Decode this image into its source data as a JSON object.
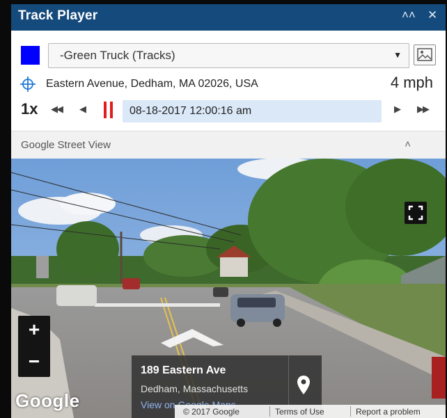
{
  "titlebar": {
    "title": "Track Player",
    "collapse_glyph": "˄˄",
    "close_glyph": "✕"
  },
  "track": {
    "swatch_color": "#0000ff",
    "selected": "-Green Truck (Tracks)",
    "caret": "▼"
  },
  "location": {
    "icon": "crosshair-icon",
    "address": "Eastern Avenue, Dedham, MA 02026, USA",
    "speed": "4 mph"
  },
  "playback": {
    "rate": "1x",
    "first_glyph": "◀◀",
    "prev_glyph": "◀",
    "timestamp": "08-18-2017 12:00:16 am",
    "next_glyph": "▶",
    "last_glyph": "▶▶",
    "pause_color": "#e21c1c"
  },
  "street_view": {
    "header": "Google Street View",
    "collapse_glyph": "˄",
    "zoom_in": "+",
    "zoom_out": "−",
    "logo": "Google",
    "card": {
      "street": "189 Eastern Ave",
      "city": "Dedham, Massachusetts",
      "link": "View on Google Maps"
    },
    "footer": {
      "copyright": "© 2017 Google",
      "terms": "Terms of Use",
      "report": "Report a problem"
    }
  },
  "colors": {
    "titlebar": "#154a7c",
    "timebox": "#dbe8f8",
    "accent_blue": "#1e78d6"
  }
}
